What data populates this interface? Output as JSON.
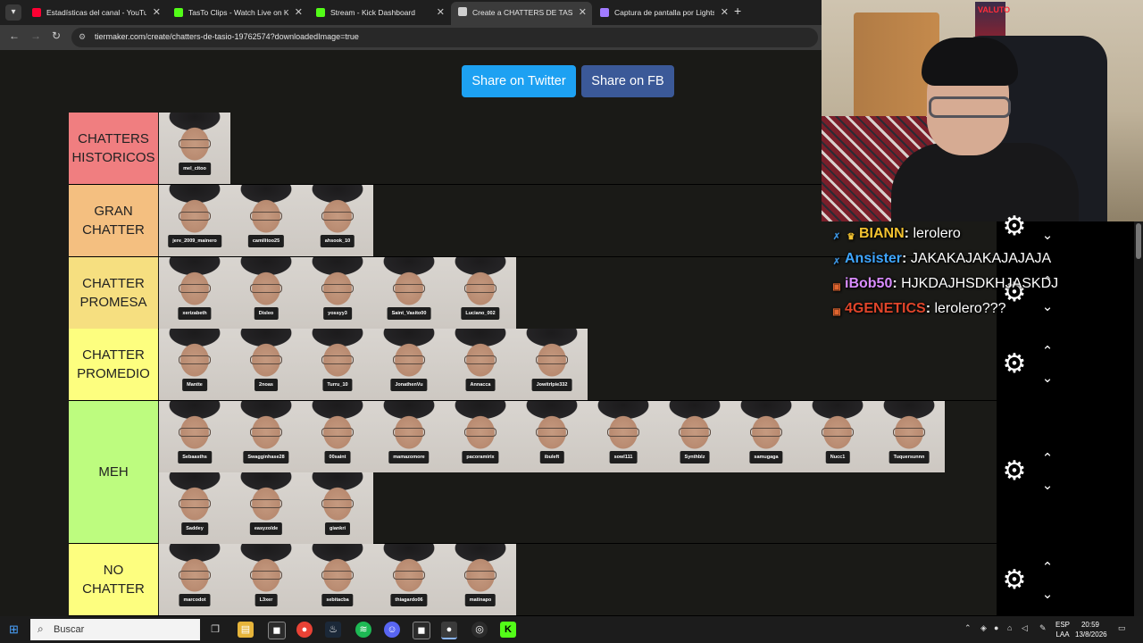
{
  "browser": {
    "tabs": [
      {
        "label": "Estadísticas del canal - YouTube",
        "favicon_color": "#ff0033",
        "active": false
      },
      {
        "label": "TasTo Clips - Watch Live on Kick",
        "favicon_color": "#53fc18",
        "active": false
      },
      {
        "label": "Stream - Kick Dashboard",
        "favicon_color": "#53fc18",
        "active": false
      },
      {
        "label": "Create a CHATTERS DE TASIO Tier List",
        "favicon_color": "#cfcfcf",
        "active": true
      },
      {
        "label": "Captura de pantalla por Lightshot",
        "favicon_color": "#a17bff",
        "active": false
      }
    ],
    "url": "tiermaker.com/create/chatters-de-tasio-19762574?downloadedImage=true"
  },
  "page": {
    "share_twitter": "Share on Twitter",
    "share_fb": "Share on FB",
    "tiers": [
      {
        "label": "CHATTERS HISTORICOS",
        "color": "#f07e80",
        "items": [
          "mel_citoo"
        ]
      },
      {
        "label": "GRAN CHATTER",
        "color": "#f4bf80",
        "items": [
          "jere_2009_mainero",
          "camilitoo25",
          "ahsook_10"
        ]
      },
      {
        "label": "CHATTER PROMESA",
        "color": "#f6df80",
        "items": [
          "xerizabeth",
          "Disleo",
          "yossyy3",
          "Saint_Vasito00",
          "Luciano_002"
        ]
      },
      {
        "label": "CHATTER PROMEDIO",
        "color": "#fdfe7f",
        "items": [
          "Mantte",
          "2noas",
          "Turru_10",
          "JonathenVu",
          "Annacca",
          "Jowitrlpie332"
        ]
      },
      {
        "label": "MEH",
        "color": "#bdfc7f",
        "items": [
          "Sebaasths",
          "Swagginhase28",
          "00saint",
          "mamazomore",
          "pacoramirix",
          "ibuleft",
          "sowl111",
          "Synthblz",
          "samugaga",
          "Nucc1",
          "Tuquersunnn",
          "Saddey",
          "easyzolde",
          "giankri"
        ]
      },
      {
        "label": "NO CHATTER",
        "color": "#fdfe7f",
        "items": [
          "marcodot",
          "L3xer",
          "sebitacba",
          "thiagardo06",
          "matinapo"
        ]
      }
    ]
  },
  "webcam": {
    "poster_text": "VALUTO"
  },
  "chat": [
    {
      "badge": "sword",
      "badge_color": "#3a8fd9",
      "badge2": "crown",
      "user": "BIANN",
      "user_color": "#f2c230",
      "message": "lerolero"
    },
    {
      "badge": "sword",
      "badge_color": "#3a8fd9",
      "user": "Ansister",
      "user_color": "#3fa6ff",
      "message": "JAKAKAJAKAJAJAJA"
    },
    {
      "badge": "box",
      "badge_color": "#e0652f",
      "user": "iBob50",
      "user_color": "#d98cff",
      "message": "HJKDAJHSDKHJASKDJ"
    },
    {
      "badge": "box",
      "badge_color": "#e0652f",
      "user": "4GENETICS",
      "user_color": "#e0452a",
      "message": "lerolero???"
    }
  ],
  "taskbar": {
    "search_placeholder": "Buscar",
    "lang_top": "ESP",
    "lang_bottom": "LAA",
    "time": "20:59",
    "date": "13/8/2026"
  }
}
